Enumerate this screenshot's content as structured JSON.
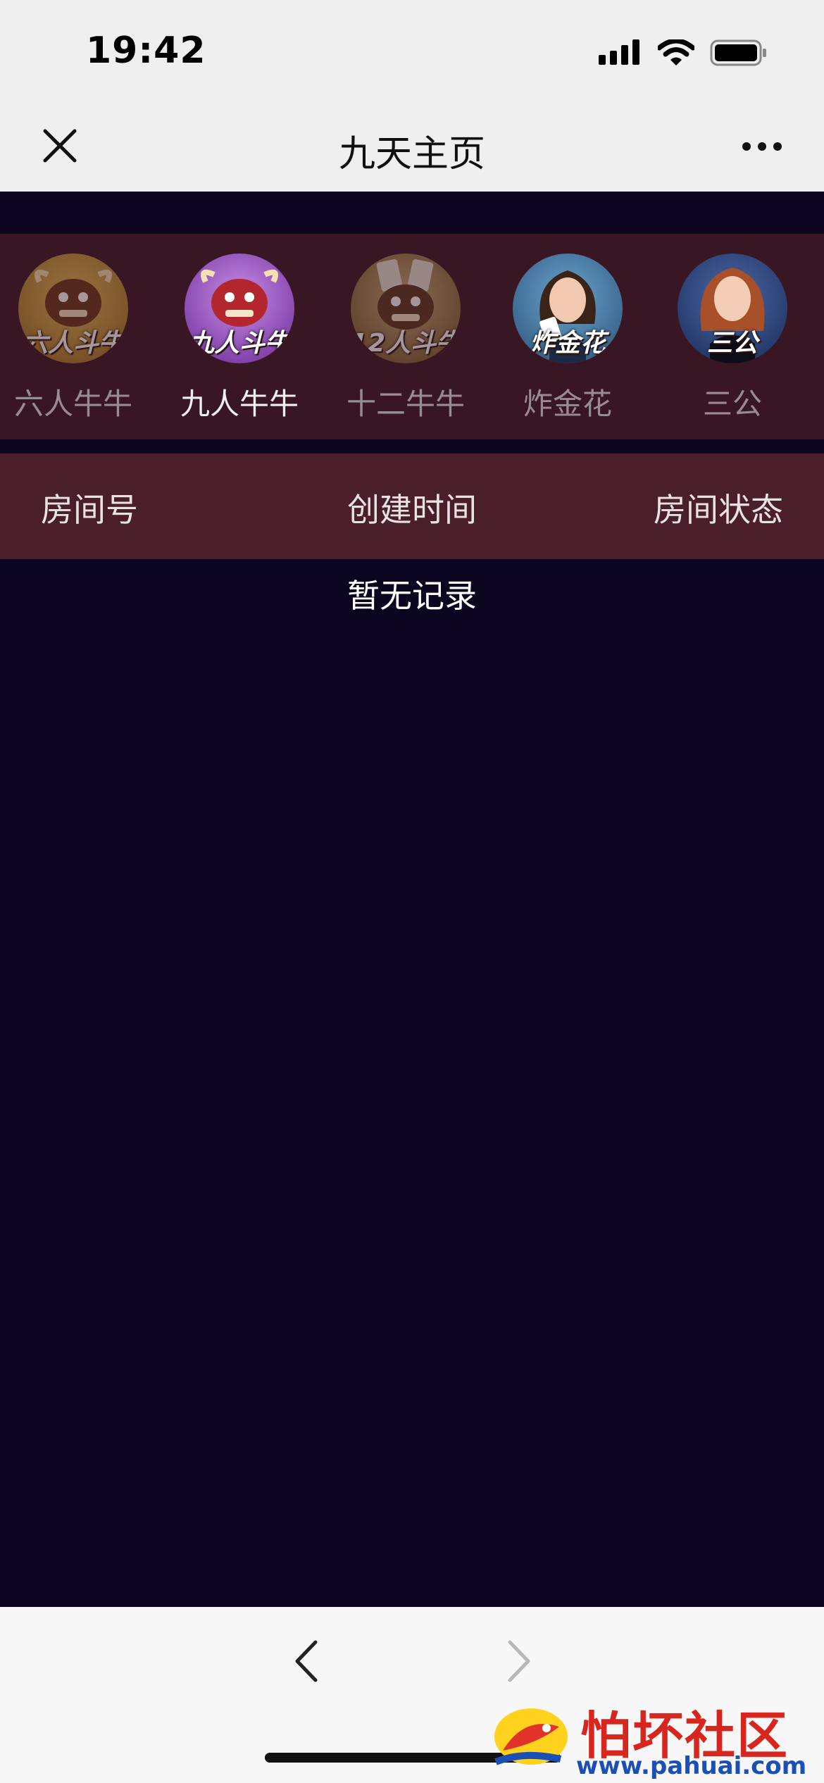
{
  "status_bar": {
    "time": "19:42"
  },
  "nav": {
    "title": "九天主页"
  },
  "games": [
    {
      "label": "六人牛牛",
      "badge": "六人斗牛",
      "icon": "bull-mascot-icon",
      "color": "#c79a2e",
      "active": false
    },
    {
      "label": "九人牛牛",
      "badge": "九人斗牛",
      "icon": "bull-mascot-icon",
      "color": "#9b4fc0",
      "active": true
    },
    {
      "label": "十二牛牛",
      "badge": "12人斗牛",
      "icon": "bull-mascot-icon",
      "color": "#8a7240",
      "active": false
    },
    {
      "label": "炸金花",
      "badge": "炸金花",
      "icon": "card-girl-icon",
      "color": "#3a6f9a",
      "active": false
    },
    {
      "label": "三公",
      "badge": "三公",
      "icon": "card-girl-icon",
      "color": "#2f4a7a",
      "active": false
    }
  ],
  "table": {
    "columns": [
      "房间号",
      "创建时间",
      "房间状态"
    ],
    "empty_text": "暂无记录"
  },
  "watermark": {
    "title": "怕坏社区",
    "url": "www.pahuai.com"
  },
  "colors": {
    "background": "#0b0520",
    "games_strip": "#381623",
    "table_header": "#4a1f29"
  }
}
